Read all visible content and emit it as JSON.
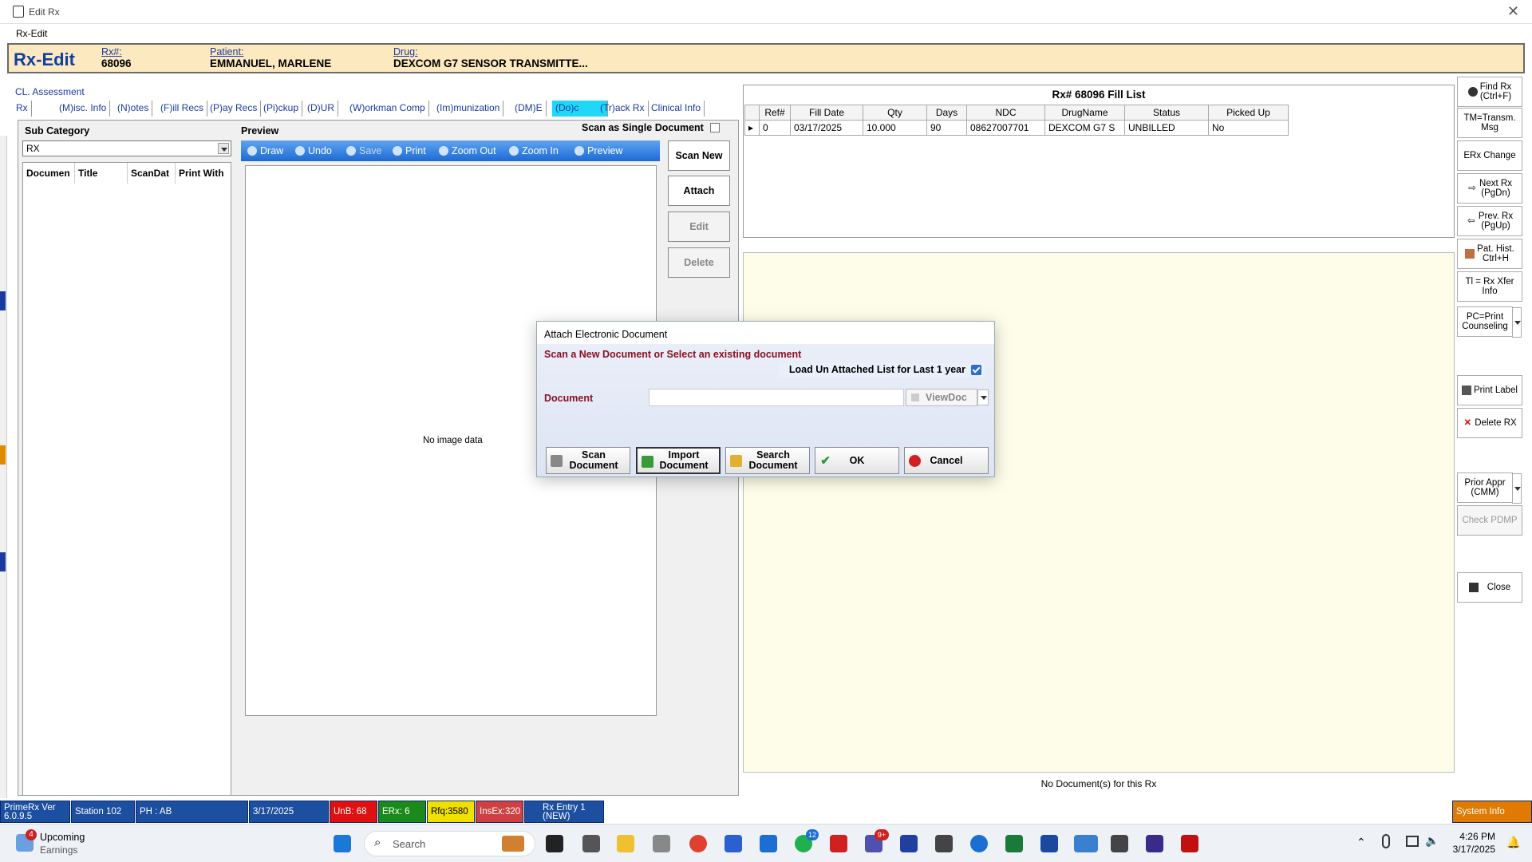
{
  "window": {
    "title": "Edit Rx",
    "menu": "Rx-Edit"
  },
  "header": {
    "title": "Rx-Edit",
    "rx_label": "Rx#:",
    "rx_value": "68096",
    "patient_label": "Patient:",
    "patient_value": "EMMANUEL, MARLENE",
    "drug_label": "Drug:",
    "drug_value": "DEXCOM G7 SENSOR TRANSMITTE..."
  },
  "cl_assessment": "CL. Assessment",
  "tabs": [
    {
      "label": "Rx"
    },
    {
      "label": "(M)isc. Info"
    },
    {
      "label": "(N)otes"
    },
    {
      "label": "(F)ill Recs"
    },
    {
      "label": "(P)ay Recs"
    },
    {
      "label": "(Pi)ckup"
    },
    {
      "label": "(D)UR"
    },
    {
      "label": "(W)orkman Comp"
    },
    {
      "label": "(Im)munization"
    },
    {
      "label": "(DM)E"
    },
    {
      "label": "(Do)c"
    },
    {
      "label": "(Tr)ack Rx"
    },
    {
      "label": "Clinical Info"
    }
  ],
  "doc": {
    "subcategory_label": "Sub Category",
    "subcategory_value": "RX",
    "list_headers": [
      "Documen",
      "Title",
      "ScanDat",
      "Print With"
    ],
    "preview_label": "Preview",
    "scan_single_label": "Scan as Single Document",
    "toolbar": {
      "draw": "Draw",
      "undo": "Undo",
      "save": "Save",
      "print": "Print",
      "zoom_out": "Zoom Out",
      "zoom_in": "Zoom In",
      "preview": "Preview"
    },
    "no_image": "No image data",
    "buttons": {
      "scan_new": "Scan New",
      "attach": "Attach",
      "edit": "Edit",
      "delete": "Delete"
    }
  },
  "fill_list": {
    "title": "Rx# 68096 Fill List",
    "headers": [
      "Ref#",
      "Fill Date",
      "Qty",
      "Days",
      "NDC",
      "DrugName",
      "Status",
      "Picked Up"
    ],
    "rows": [
      [
        "0",
        "03/17/2025",
        "10.000",
        "90",
        "08627007701",
        "DEXCOM G7 S",
        "UNBILLED",
        "No"
      ]
    ]
  },
  "no_documents": "No Document(s) for this Rx",
  "sidebar": {
    "find_rx": "Find Rx\n(Ctrl+F)",
    "tm": "TM=Transm.\nMsg",
    "erx_change": "ERx Change",
    "next_rx": "Next Rx\n(PgDn)",
    "prev_rx": "Prev. Rx\n(PgUp)",
    "pat_hist": "Pat. Hist.\nCtrl+H",
    "tl_xfer": "Tl = Rx Xfer\nInfo",
    "pc_print": "PC=Print\nCounseling",
    "print_label": "Print Label",
    "delete_rx": "Delete RX",
    "prior_appr": "Prior Appr\n(CMM)",
    "check_pdmp": "Check PDMP",
    "close": "Close"
  },
  "dialog": {
    "title": "Attach Electronic Document",
    "subtitle": "Scan a New Document or Select an existing document",
    "load_label": "Load Un Attached List for Last 1 year",
    "load_checked": true,
    "document_label": "Document",
    "document_value": "",
    "viewdoc": "ViewDoc",
    "buttons": {
      "scan": "Scan\nDocument",
      "import": "Import\nDocument",
      "search": "Search\nDocument",
      "ok": "OK",
      "cancel": "Cancel"
    }
  },
  "statusbar": {
    "version": "PrimeRx Ver\n6.0.9.5",
    "station": "Station 102",
    "ph": "PH : AB",
    "date": "3/17/2025",
    "unb": "UnB: 68",
    "erx": "ERx: 6",
    "rfq": "Rfq:3580",
    "insex": "InsEx:320",
    "rx_entry": "Rx Entry 1\n(NEW)",
    "system_info": "System Info"
  },
  "taskbar": {
    "weather_title": "Upcoming",
    "weather_sub": "Earnings",
    "badge": "4",
    "search_placeholder": "Search",
    "time": "4:26 PM",
    "date": "3/17/2025",
    "teams_badge": "12",
    "teams2_badge": "9+"
  },
  "colors": {
    "header_bg": "#fde9bf",
    "selected_tab": "#1fd8f8",
    "toolbar": "#1c6ad4",
    "unb_red": "#e01010",
    "erx_green": "#1a8a1a",
    "rfq_yellow": "#f0e000",
    "insex_red": "#d04040"
  }
}
